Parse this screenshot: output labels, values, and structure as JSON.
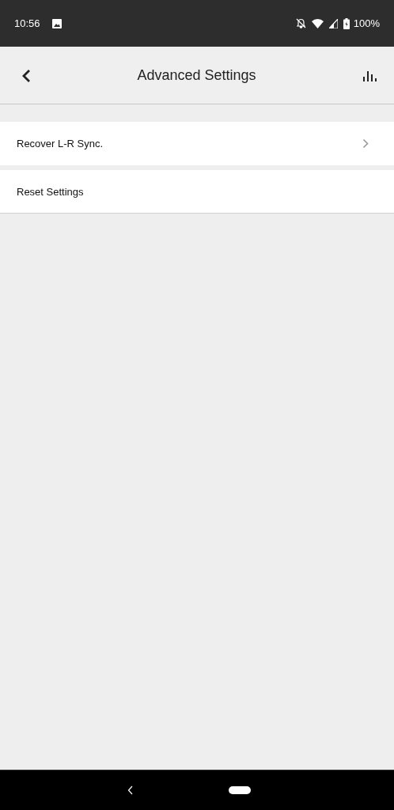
{
  "status_bar": {
    "time": "10:56",
    "battery": "100%"
  },
  "app_bar": {
    "title": "Advanced Settings"
  },
  "items": [
    {
      "label": "Recover L-R Sync.",
      "kind": "link"
    },
    {
      "label": "Reset Settings",
      "kind": "action"
    }
  ]
}
